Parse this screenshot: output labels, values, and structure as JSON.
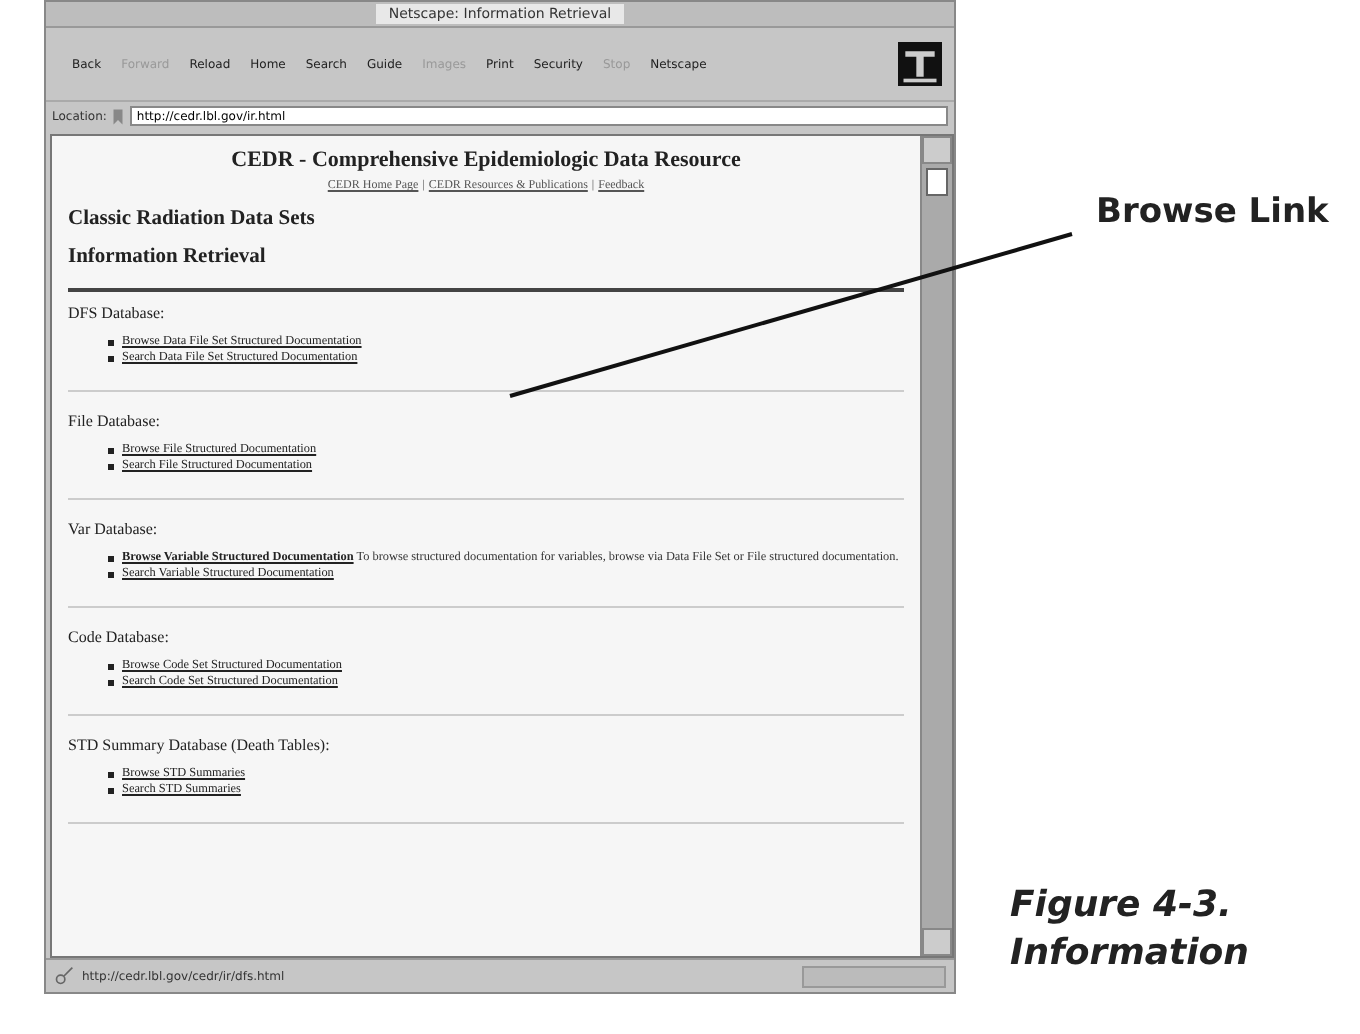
{
  "window": {
    "title": "Netscape: Information Retrieval"
  },
  "toolbar": {
    "buttons": [
      {
        "label": "Back",
        "disabled": false
      },
      {
        "label": "Forward",
        "disabled": true
      },
      {
        "label": "Reload",
        "disabled": false
      },
      {
        "label": "Home",
        "disabled": false
      },
      {
        "label": "Search",
        "disabled": false
      },
      {
        "label": "Guide",
        "disabled": false
      },
      {
        "label": "Images",
        "disabled": true
      },
      {
        "label": "Print",
        "disabled": false
      },
      {
        "label": "Security",
        "disabled": false
      },
      {
        "label": "Stop",
        "disabled": true
      },
      {
        "label": "Netscape",
        "disabled": false
      }
    ]
  },
  "location": {
    "label": "Location:",
    "value": "http://cedr.lbl.gov/ir.html"
  },
  "page": {
    "title": "CEDR - Comprehensive Epidemiologic Data Resource",
    "nav": [
      {
        "kind": "link",
        "text": "CEDR Home Page"
      },
      {
        "kind": "separator",
        "text": "|"
      },
      {
        "kind": "link",
        "text": "CEDR Resources & Publications"
      },
      {
        "kind": "separator",
        "text": "|"
      },
      {
        "kind": "link",
        "text": "Feedback"
      }
    ],
    "headings": [
      "Classic Radiation Data Sets",
      "Information Retrieval"
    ],
    "sections": [
      {
        "heading": "DFS Database:",
        "items": [
          {
            "link": "Browse Data File Set Structured Documentation",
            "emphasized": false
          },
          {
            "link": "Search Data File Set Structured Documentation",
            "emphasized": false
          }
        ]
      },
      {
        "heading": "File Database:",
        "items": [
          {
            "link": "Browse File Structured Documentation",
            "emphasized": false
          },
          {
            "link": "Search File Structured Documentation",
            "emphasized": false
          }
        ]
      },
      {
        "heading": "Var Database:",
        "items": [
          {
            "link": "Browse Variable Structured Documentation",
            "emphasized": true,
            "note": "To browse structured documentation for variables, browse via Data File Set or File structured documentation."
          },
          {
            "link": "Search Variable Structured Documentation",
            "emphasized": false
          }
        ]
      },
      {
        "heading": "Code Database:",
        "items": [
          {
            "link": "Browse Code Set Structured Documentation",
            "emphasized": false
          },
          {
            "link": "Search Code Set Structured Documentation",
            "emphasized": false
          }
        ]
      },
      {
        "heading": "STD Summary Database (Death Tables):",
        "items": [
          {
            "link": "Browse STD Summaries",
            "emphasized": false
          },
          {
            "link": "Search STD Summaries",
            "emphasized": false
          }
        ]
      }
    ]
  },
  "status_bar": {
    "text": "http://cedr.lbl.gov/cedr/ir/dfs.html"
  },
  "callout": {
    "label": "Browse Link"
  },
  "caption": [
    "Figure 4-3.",
    "Information"
  ]
}
